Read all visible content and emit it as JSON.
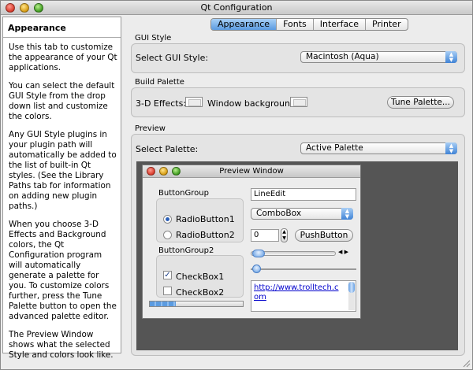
{
  "window": {
    "title": "Qt Configuration"
  },
  "help": {
    "title": "Appearance",
    "paragraphs": [
      "Use this tab to customize the appearance of your Qt applications.",
      "You can select the default GUI Style from the drop down list and customize the colors.",
      "Any GUI Style plugins in your plugin path will automatically be added to the list of built-in Qt styles. (See the Library Paths tab for information on adding new plugin paths.)",
      "When you choose 3-D Effects and Background colors, the Qt Configuration program will automatically generate a palette for you. To customize colors further, press the Tune Palette button to open the advanced palette editor.",
      "The Preview Window shows what the selected Style and colors look like."
    ]
  },
  "tabs": [
    {
      "label": "Appearance",
      "active": true
    },
    {
      "label": "Fonts",
      "active": false
    },
    {
      "label": "Interface",
      "active": false
    },
    {
      "label": "Printer",
      "active": false
    }
  ],
  "gui_style": {
    "section_label": "GUI Style",
    "select_label": "Select GUI Style:",
    "selected": "Macintosh (Aqua)"
  },
  "build_palette": {
    "section_label": "Build Palette",
    "effects_label": "3-D Effects:",
    "background_label": "Window background:",
    "tune_button": "Tune Palette..."
  },
  "preview": {
    "section_label": "Preview",
    "select_label": "Select Palette:",
    "selected": "Active Palette",
    "window_title": "Preview Window",
    "group1_title": "ButtonGroup",
    "radio1": "RadioButton1",
    "radio2": "RadioButton2",
    "radio1_checked": true,
    "group2_title": "ButtonGroup2",
    "check1": "CheckBox1",
    "check2": "CheckBox2",
    "check1_checked": true,
    "line_edit": "LineEdit",
    "combo": "ComboBox",
    "spin_value": "0",
    "push_button": "PushButton",
    "link_text": "http://www.trolltech.com",
    "progress_fraction": 0.28
  },
  "colors": {
    "accent": "#5b9be0",
    "canvas": "#555555"
  }
}
